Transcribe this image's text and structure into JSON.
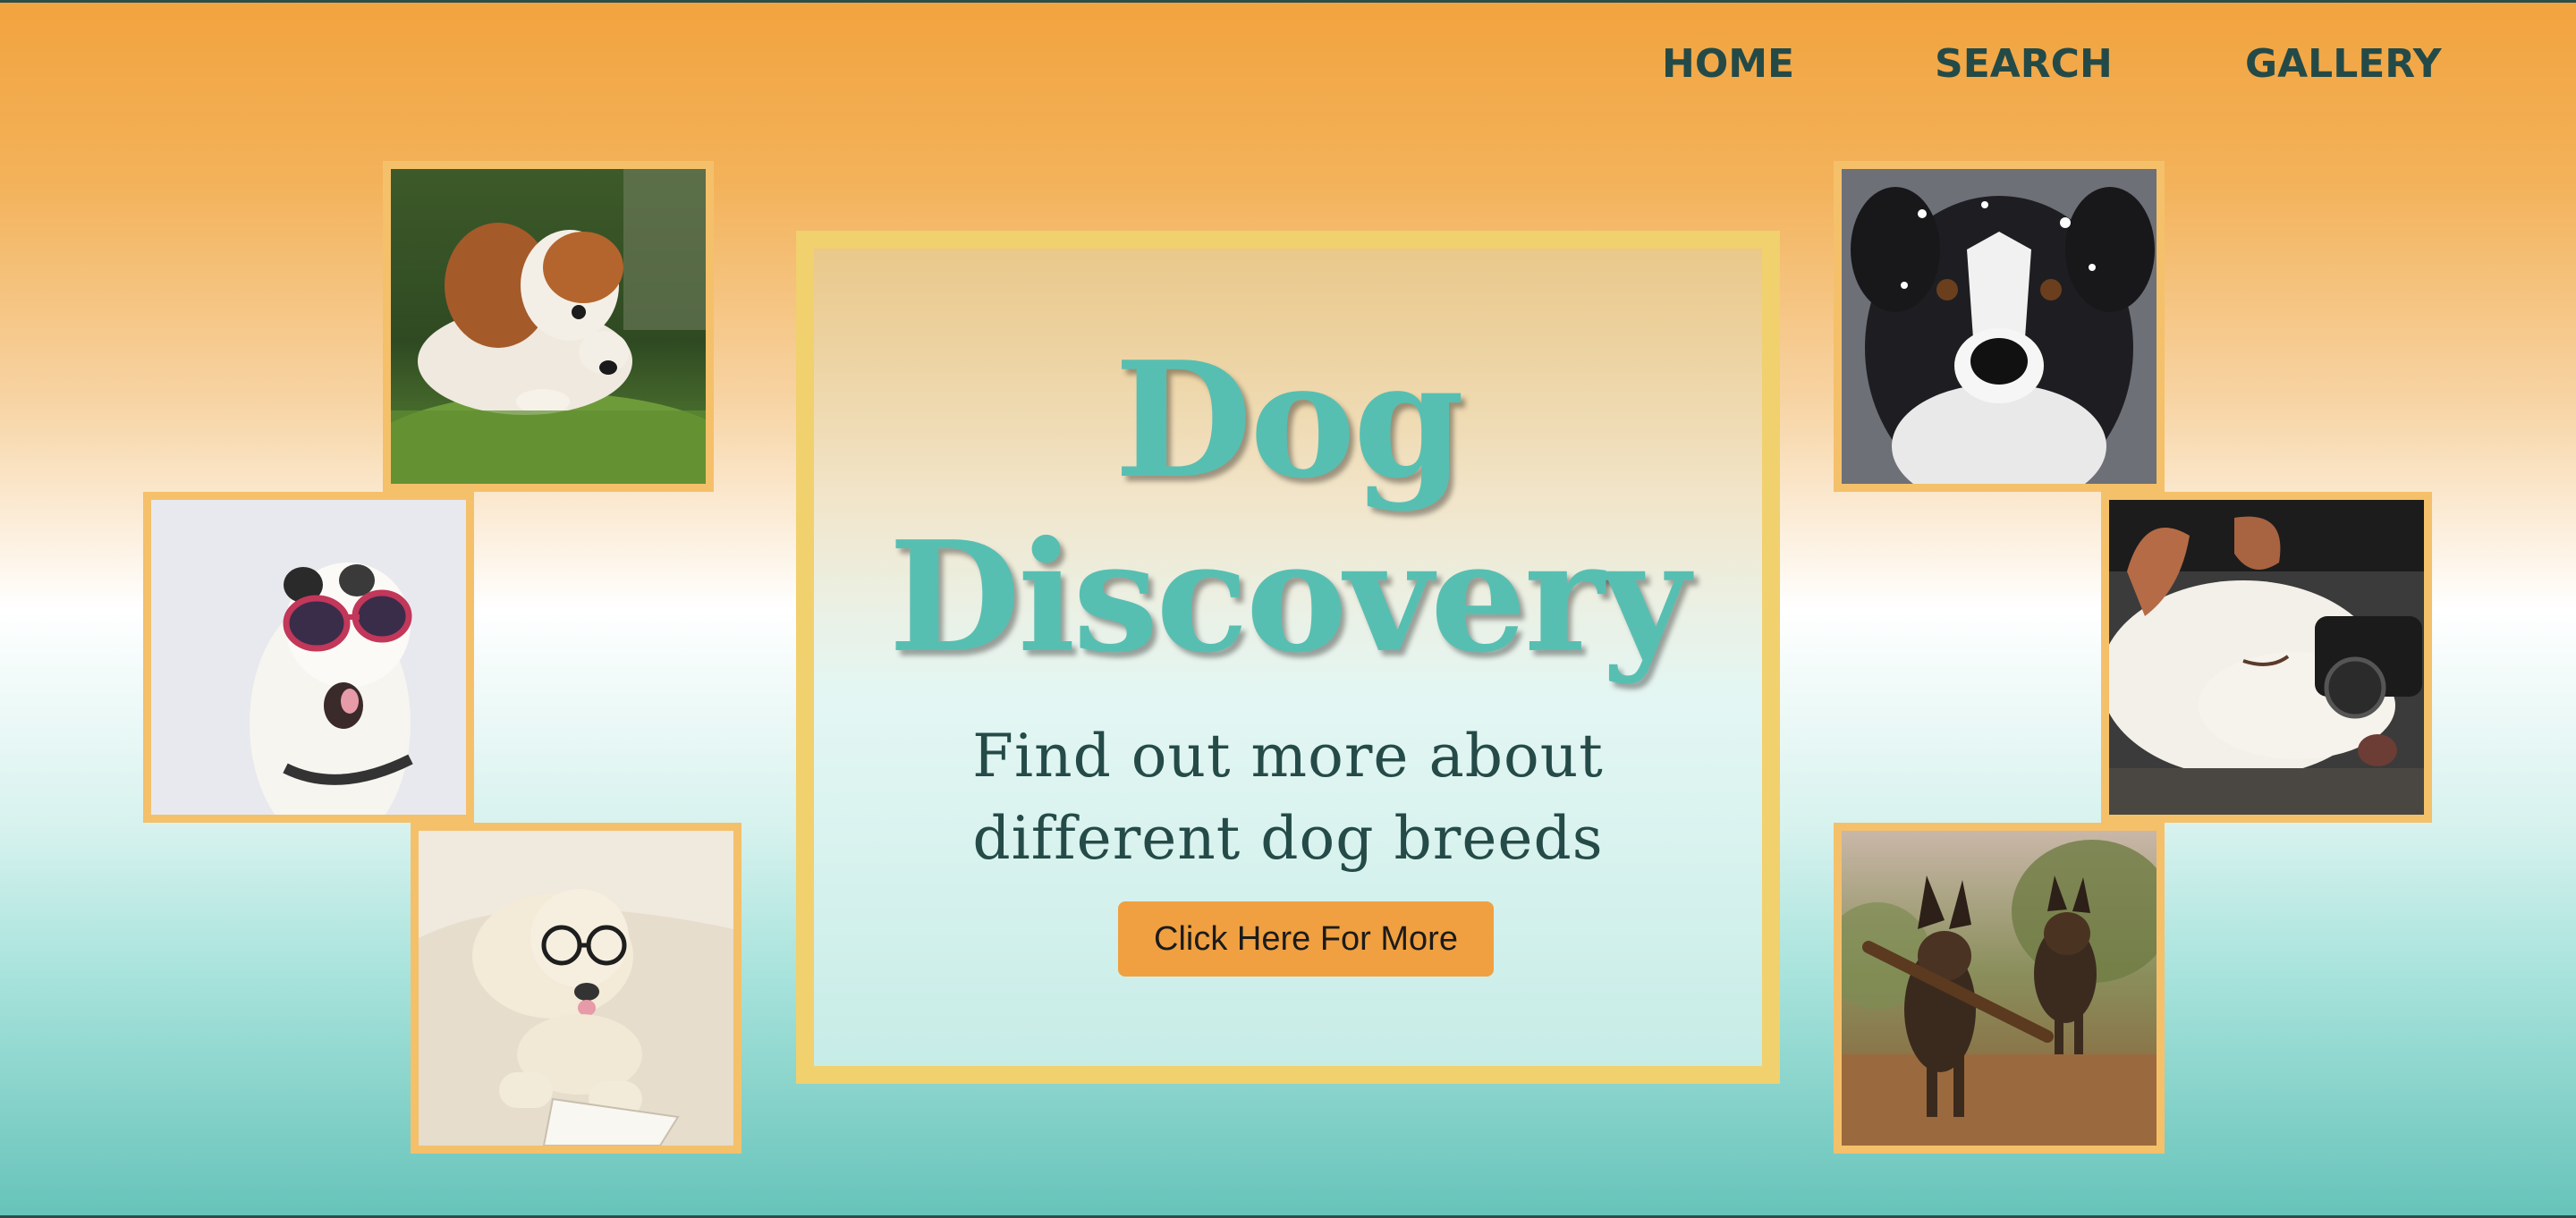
{
  "nav": {
    "home": "HOME",
    "search": "SEARCH",
    "gallery": "GALLERY"
  },
  "hero": {
    "title_line1": "Dog",
    "title_line2": "Discovery",
    "subtitle_line1": "Find out more about",
    "subtitle_line2": "different dog breeds",
    "button_label": "Click Here For More"
  },
  "photos": [
    {
      "name": "photo-puppy-in-grass"
    },
    {
      "name": "photo-dog-with-sunglasses"
    },
    {
      "name": "photo-dog-with-glasses-on-bed"
    },
    {
      "name": "photo-border-collie-in-snow"
    },
    {
      "name": "photo-sleeping-dog-with-camera"
    },
    {
      "name": "photo-two-shepherds-with-stick"
    }
  ],
  "colors": {
    "accent_teal": "#57bfb2",
    "frame_gold": "#f5c06a",
    "button_orange": "#f0a040",
    "text_dark": "#254b48"
  }
}
